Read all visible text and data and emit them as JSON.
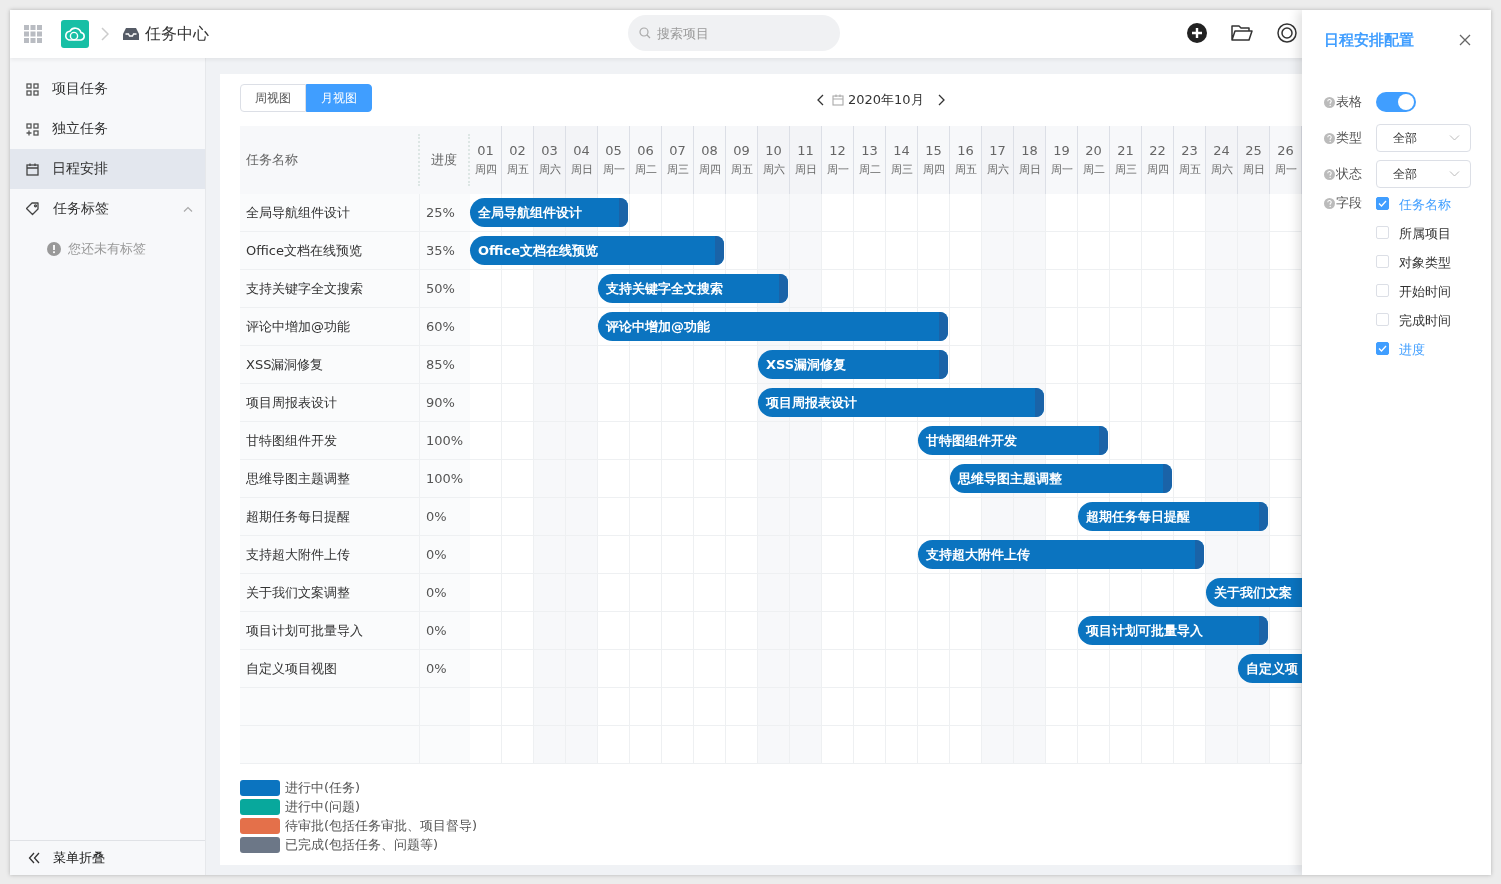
{
  "topbar": {
    "title": "任务中心",
    "search": {
      "placeholder": "搜索项目"
    }
  },
  "sidebar": {
    "items": [
      {
        "label": "项目任务",
        "selected": false
      },
      {
        "label": "独立任务",
        "selected": false
      },
      {
        "label": "日程安排",
        "selected": true
      },
      {
        "label": "任务标签",
        "selected": false,
        "expanded": true,
        "children": [
          {
            "label": "您还未有标签",
            "kind": "notice"
          }
        ]
      }
    ],
    "collapse": "菜单折叠"
  },
  "view_tabs": [
    {
      "label": "周视图",
      "selected": false
    },
    {
      "label": "月视图",
      "selected": true
    }
  ],
  "month": "2020年10月",
  "gantt": {
    "columns": [
      "任务名称",
      "进度"
    ],
    "days": [
      {
        "date": "01",
        "weekday": "周四"
      },
      {
        "date": "02",
        "weekday": "周五"
      },
      {
        "date": "03",
        "weekday": "周六"
      },
      {
        "date": "04",
        "weekday": "周日"
      },
      {
        "date": "05",
        "weekday": "周一"
      },
      {
        "date": "06",
        "weekday": "周二"
      },
      {
        "date": "07",
        "weekday": "周三"
      },
      {
        "date": "08",
        "weekday": "周四"
      },
      {
        "date": "09",
        "weekday": "周五"
      },
      {
        "date": "10",
        "weekday": "周六"
      },
      {
        "date": "11",
        "weekday": "周日"
      },
      {
        "date": "12",
        "weekday": "周一"
      },
      {
        "date": "13",
        "weekday": "周二"
      },
      {
        "date": "14",
        "weekday": "周三"
      },
      {
        "date": "15",
        "weekday": "周四"
      },
      {
        "date": "16",
        "weekday": "周五"
      },
      {
        "date": "17",
        "weekday": "周六"
      },
      {
        "date": "18",
        "weekday": "周日"
      },
      {
        "date": "19",
        "weekday": "周一"
      },
      {
        "date": "20",
        "weekday": "周二"
      },
      {
        "date": "21",
        "weekday": "周三"
      },
      {
        "date": "22",
        "weekday": "周四"
      },
      {
        "date": "23",
        "weekday": "周五"
      },
      {
        "date": "24",
        "weekday": "周六"
      },
      {
        "date": "25",
        "weekday": "周日"
      },
      {
        "date": "26",
        "weekday": "周一"
      }
    ],
    "rows": [
      {
        "name": "全局导航组件设计",
        "progress": "25%",
        "bar": "全局导航组件设计"
      },
      {
        "name": "Office文档在线预览",
        "progress": "35%",
        "bar": "Office文档在线预览"
      },
      {
        "name": "支持关键字全文搜索",
        "progress": "50%",
        "bar": "支持关键字全文搜索"
      },
      {
        "name": "评论中增加@功能",
        "progress": "60%",
        "bar": "评论中增加@功能"
      },
      {
        "name": "XSS漏洞修复",
        "progress": "85%",
        "bar": "XSS漏洞修复"
      },
      {
        "name": "项目周报表设计",
        "progress": "90%",
        "bar": "项目周报表设计"
      },
      {
        "name": "甘特图组件开发",
        "progress": "100%",
        "bar": "甘特图组件开发"
      },
      {
        "name": "思维导图主题调整",
        "progress": "100%",
        "bar": "思维导图主题调整"
      },
      {
        "name": "超期任务每日提醒",
        "progress": "0%",
        "bar": "超期任务每日提醒"
      },
      {
        "name": "支持超大附件上传",
        "progress": "0%",
        "bar": "支持超大附件上传"
      },
      {
        "name": "关于我们文案调整",
        "progress": "0%",
        "bar": "关于我们文案"
      },
      {
        "name": "项目计划可批量导入",
        "progress": "0%",
        "bar": "项目计划可批量导入"
      },
      {
        "name": "自定义项目视图",
        "progress": "0%",
        "bar": "自定义项"
      }
    ]
  },
  "legend": [
    {
      "label": "进行中(任务)",
      "color": "#0b74c0"
    },
    {
      "label": "进行中(问题)",
      "color": "#08a89c"
    },
    {
      "label": "待审批(包括任务审批、项目督导)",
      "color": "#e4704a"
    },
    {
      "label": "已完成(包括任务、问题等)",
      "color": "#6c7787"
    }
  ],
  "drawer": {
    "title": "日程安排配置",
    "table": {
      "label": "表格",
      "on": true
    },
    "selects": [
      {
        "label": "类型",
        "value": "全部"
      },
      {
        "label": "状态",
        "value": "全部"
      }
    ],
    "fields": {
      "label": "字段",
      "options": [
        {
          "label": "任务名称",
          "checked": true
        },
        {
          "label": "所属项目",
          "checked": false
        },
        {
          "label": "对象类型",
          "checked": false
        },
        {
          "label": "开始时间",
          "checked": false
        },
        {
          "label": "完成时间",
          "checked": false
        },
        {
          "label": "进度",
          "checked": true
        }
      ]
    }
  }
}
